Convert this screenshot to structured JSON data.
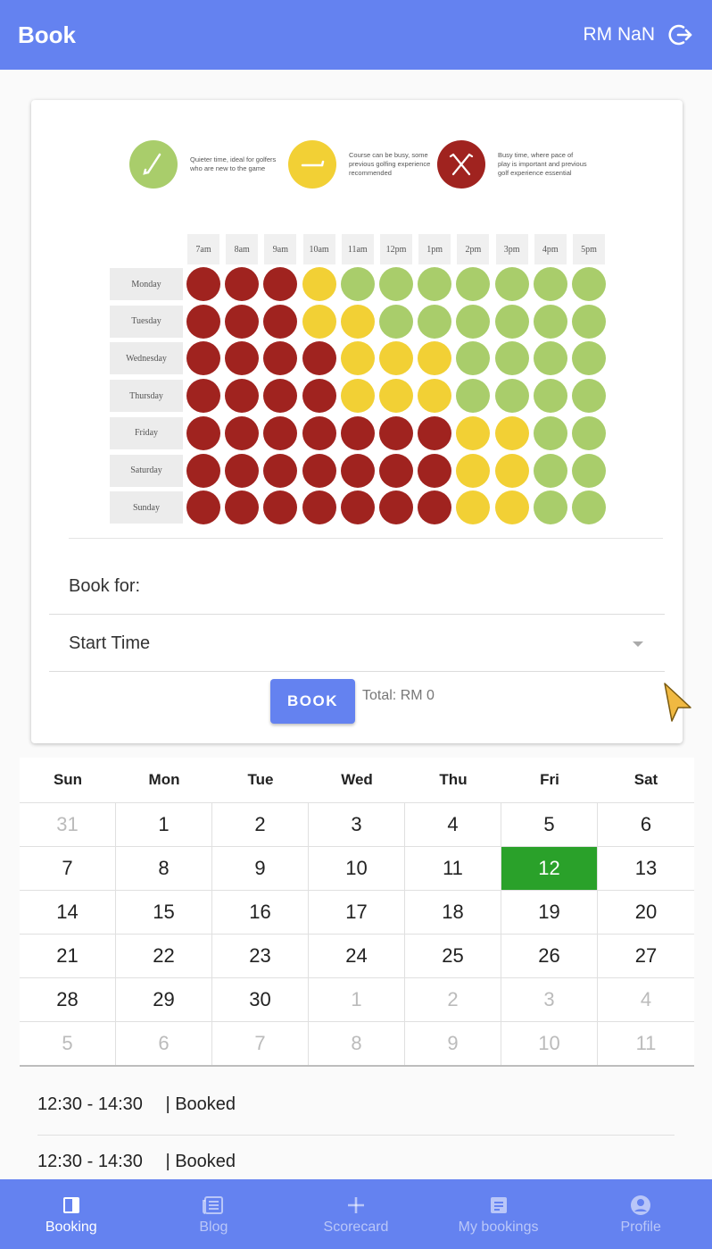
{
  "header": {
    "title": "Book",
    "balance": "RM NaN",
    "logout_icon": "logout-icon"
  },
  "legend": [
    {
      "color": "#a9cd6b",
      "icon": "golf-club-icon",
      "text": "Quieter time, ideal for golfers who are new to the game"
    },
    {
      "color": "#f2d035",
      "icon": "golf-club-icon",
      "text": "Course can be busy, some previous golfing experience recommended"
    },
    {
      "color": "#a0231f",
      "icon": "crossed-clubs-icon",
      "text": "Busy time, where pace of play is important and previous golf experience essential"
    }
  ],
  "heatmap": {
    "times": [
      "7am",
      "8am",
      "9am",
      "10am",
      "11am",
      "12pm",
      "1pm",
      "2pm",
      "3pm",
      "4pm",
      "5pm"
    ],
    "days": [
      "Monday",
      "Tuesday",
      "Wednesday",
      "Thursday",
      "Friday",
      "Saturday",
      "Sunday"
    ],
    "levels": [
      [
        "red",
        "red",
        "red",
        "yellow",
        "green",
        "green",
        "green",
        "green",
        "green",
        "green",
        "green"
      ],
      [
        "red",
        "red",
        "red",
        "yellow",
        "yellow",
        "green",
        "green",
        "green",
        "green",
        "green",
        "green"
      ],
      [
        "red",
        "red",
        "red",
        "red",
        "yellow",
        "yellow",
        "yellow",
        "green",
        "green",
        "green",
        "green"
      ],
      [
        "red",
        "red",
        "red",
        "red",
        "yellow",
        "yellow",
        "yellow",
        "green",
        "green",
        "green",
        "green"
      ],
      [
        "red",
        "red",
        "red",
        "red",
        "red",
        "red",
        "red",
        "yellow",
        "yellow",
        "green",
        "green"
      ],
      [
        "red",
        "red",
        "red",
        "red",
        "red",
        "red",
        "red",
        "yellow",
        "yellow",
        "green",
        "green"
      ],
      [
        "red",
        "red",
        "red",
        "red",
        "red",
        "red",
        "red",
        "yellow",
        "yellow",
        "green",
        "green"
      ]
    ]
  },
  "form": {
    "book_for_label": "Book for:",
    "start_time_label": "Start Time",
    "book_button": "BOOK",
    "total": "Total: RM 0"
  },
  "calendar": {
    "weekdays": [
      "Sun",
      "Mon",
      "Tue",
      "Wed",
      "Thu",
      "Fri",
      "Sat"
    ],
    "weeks": [
      [
        {
          "d": "31",
          "m": true
        },
        {
          "d": "1"
        },
        {
          "d": "2"
        },
        {
          "d": "3"
        },
        {
          "d": "4"
        },
        {
          "d": "5"
        },
        {
          "d": "6"
        }
      ],
      [
        {
          "d": "7"
        },
        {
          "d": "8"
        },
        {
          "d": "9"
        },
        {
          "d": "10"
        },
        {
          "d": "11"
        },
        {
          "d": "12",
          "s": true
        },
        {
          "d": "13"
        }
      ],
      [
        {
          "d": "14"
        },
        {
          "d": "15"
        },
        {
          "d": "16"
        },
        {
          "d": "17"
        },
        {
          "d": "18"
        },
        {
          "d": "19"
        },
        {
          "d": "20"
        }
      ],
      [
        {
          "d": "21"
        },
        {
          "d": "22"
        },
        {
          "d": "23"
        },
        {
          "d": "24"
        },
        {
          "d": "25"
        },
        {
          "d": "26"
        },
        {
          "d": "27"
        }
      ],
      [
        {
          "d": "28"
        },
        {
          "d": "29"
        },
        {
          "d": "30"
        },
        {
          "d": "1",
          "m": true
        },
        {
          "d": "2",
          "m": true
        },
        {
          "d": "3",
          "m": true
        },
        {
          "d": "4",
          "m": true
        }
      ],
      [
        {
          "d": "5",
          "m": true
        },
        {
          "d": "6",
          "m": true
        },
        {
          "d": "7",
          "m": true
        },
        {
          "d": "8",
          "m": true
        },
        {
          "d": "9",
          "m": true
        },
        {
          "d": "10",
          "m": true
        },
        {
          "d": "11",
          "m": true
        }
      ]
    ],
    "selected_color": "#2aa12a"
  },
  "bookings": [
    {
      "time": "12:30 - 14:30",
      "status": "| Booked"
    },
    {
      "time": "12:30 - 14:30",
      "status": "| Booked"
    }
  ],
  "nav": [
    {
      "label": "Booking",
      "icon": "book-icon",
      "active": true
    },
    {
      "label": "Blog",
      "icon": "blog-icon",
      "active": false
    },
    {
      "label": "Scorecard",
      "icon": "plus-icon",
      "active": false
    },
    {
      "label": "My bookings",
      "icon": "bookings-list-icon",
      "active": false
    },
    {
      "label": "Profile",
      "icon": "profile-icon",
      "active": false
    }
  ],
  "colors": {
    "primary": "#6482f0",
    "red": "#a0231f",
    "yellow": "#f2d035",
    "green": "#a9cd6b"
  }
}
